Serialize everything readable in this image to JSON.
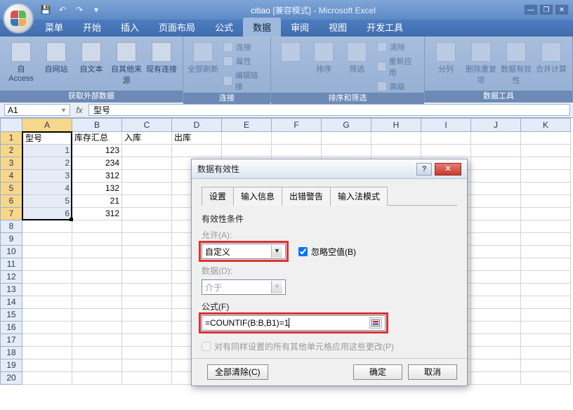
{
  "title": {
    "app": "Microsoft Excel",
    "filename": "citiao",
    "mode": "[兼容模式]"
  },
  "menutabs": [
    "菜单",
    "开始",
    "插入",
    "页面布局",
    "公式",
    "数据",
    "审阅",
    "视图",
    "开发工具"
  ],
  "menutabs_active_index": 5,
  "ribbon": {
    "groups": [
      {
        "label": "获取外部数据",
        "big": [
          "自 Access",
          "自网站",
          "自文本",
          "自其他来源",
          "现有连接"
        ]
      },
      {
        "label": "连接",
        "big": [
          "全部刷新"
        ],
        "small": [
          "连接",
          "属性",
          "编辑链接"
        ]
      },
      {
        "label": "排序和筛选",
        "big": [
          "",
          "排序",
          "筛选"
        ],
        "small": [
          "清除",
          "重新应用",
          "高级"
        ]
      },
      {
        "label": "数据工具",
        "big": [
          "分列",
          "删除重复项",
          "数据有效性",
          "合并计算"
        ]
      }
    ]
  },
  "fbar": {
    "name": "A1",
    "formula": "型号"
  },
  "columns": [
    "A",
    "B",
    "C",
    "D",
    "E",
    "F",
    "G",
    "H",
    "I",
    "J",
    "K"
  ],
  "rows_visible": 20,
  "sheet": {
    "headers": [
      "型号",
      "库存汇总",
      "入库",
      "出库"
    ],
    "data": [
      [
        "1",
        "123"
      ],
      [
        "2",
        "234"
      ],
      [
        "3",
        "312"
      ],
      [
        "4",
        "132"
      ],
      [
        "5",
        "21"
      ],
      [
        "6",
        "312"
      ]
    ]
  },
  "dialog": {
    "title": "数据有效性",
    "tabs": [
      "设置",
      "输入信息",
      "出错警告",
      "输入法模式"
    ],
    "active_tab": 0,
    "section_label": "有效性条件",
    "allow_label": "允许(A):",
    "allow_value": "自定义",
    "ignore_blank_label": "忽略空值(B)",
    "ignore_blank_checked": true,
    "data_label": "数据(D):",
    "data_value": "介于",
    "formula_label": "公式(F)",
    "formula_value": "=COUNTIF(B:B,B1)=1",
    "apply_all_label": "对有同样设置的所有其他单元格应用这些更改(P)",
    "clear_all": "全部清除(C)",
    "ok": "确定",
    "cancel": "取消"
  }
}
